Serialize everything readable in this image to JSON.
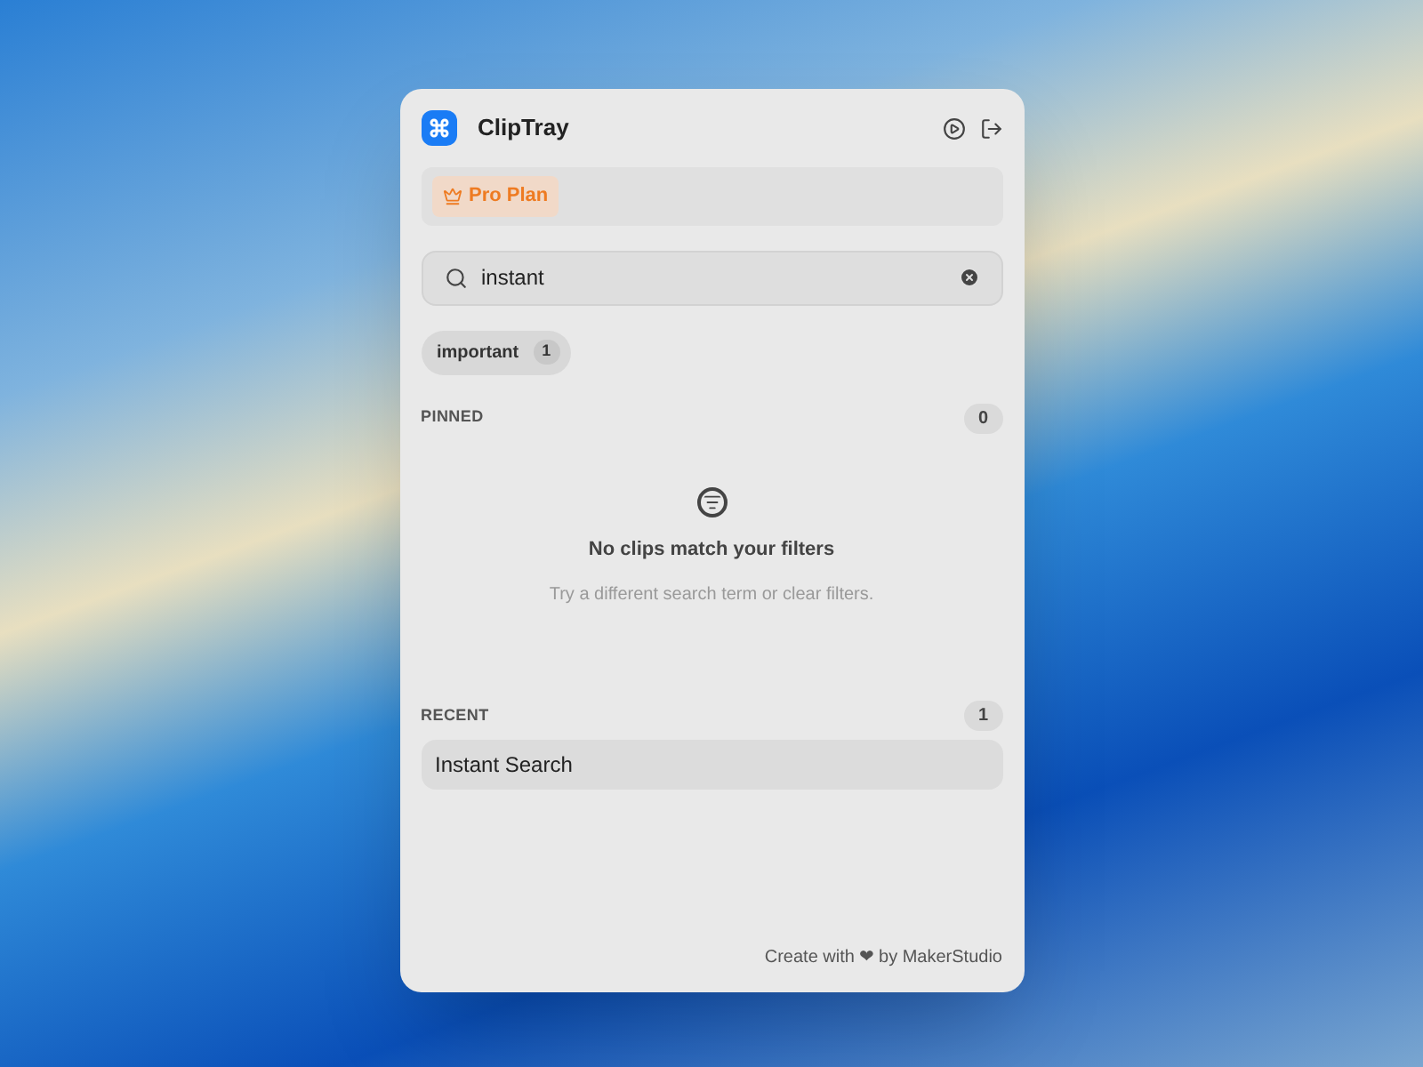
{
  "app": {
    "title": "ClipTray"
  },
  "plan": {
    "label": "Pro Plan"
  },
  "search": {
    "value": "instant"
  },
  "filters": [
    {
      "label": "important",
      "count": "1",
      "selected": true
    }
  ],
  "pinned": {
    "heading": "PINNED",
    "count": "0",
    "empty_title": "No clips match your filters",
    "empty_hint": "Try a different search term or clear filters."
  },
  "recent": {
    "heading": "RECENT",
    "count": "1",
    "items": [
      "Instant Search"
    ]
  },
  "footer": "Create with ❤ by MakerStudio"
}
